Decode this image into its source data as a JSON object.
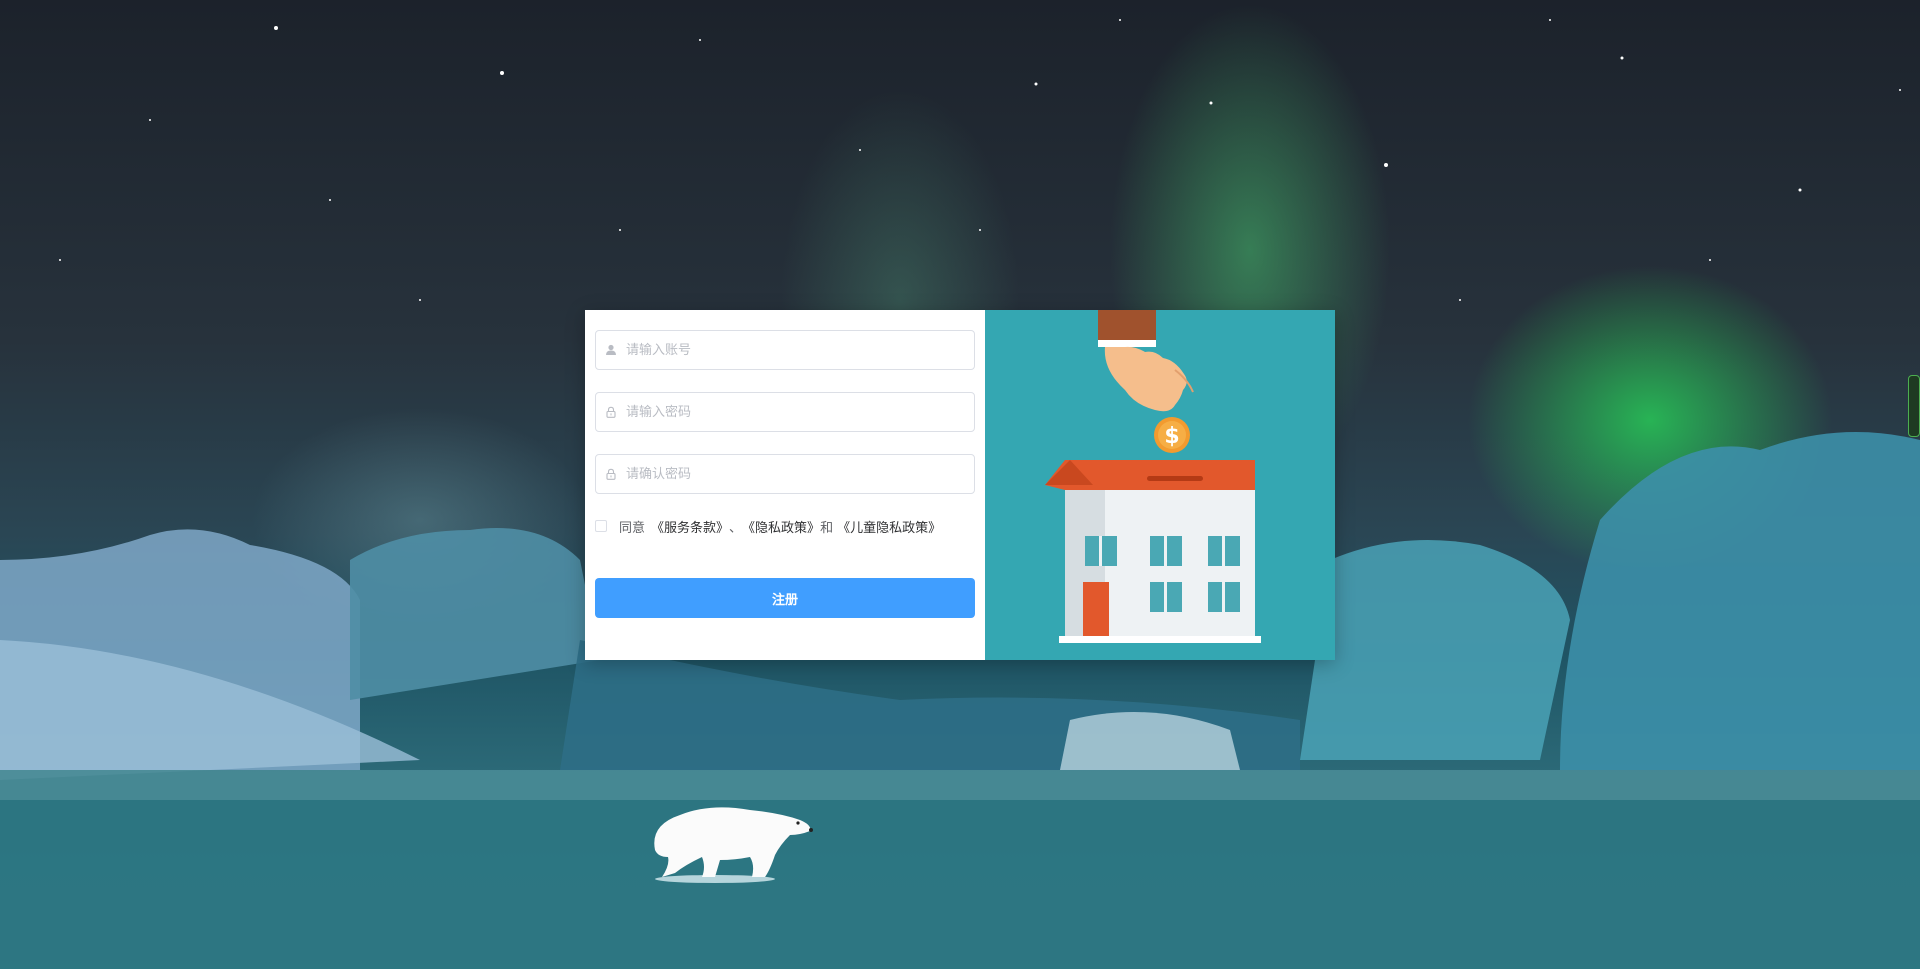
{
  "form": {
    "account_placeholder": "请输入账号",
    "password_placeholder": "请输入密码",
    "confirm_placeholder": "请确认密码",
    "agreement": {
      "prefix": "同意",
      "service_terms": "《服务条款》",
      "separator": "、",
      "privacy_policy": "《隐私政策》",
      "and": "和",
      "child_privacy": "《儿童隐私政策》",
      "checked": false
    },
    "register_label": "注册"
  },
  "icons": {
    "account": "user-icon",
    "password": "lock-icon",
    "confirm": "lock-icon"
  },
  "colors": {
    "primary": "#409eff",
    "illustration_bg": "#34a7b2",
    "roof": "#e2582c"
  }
}
